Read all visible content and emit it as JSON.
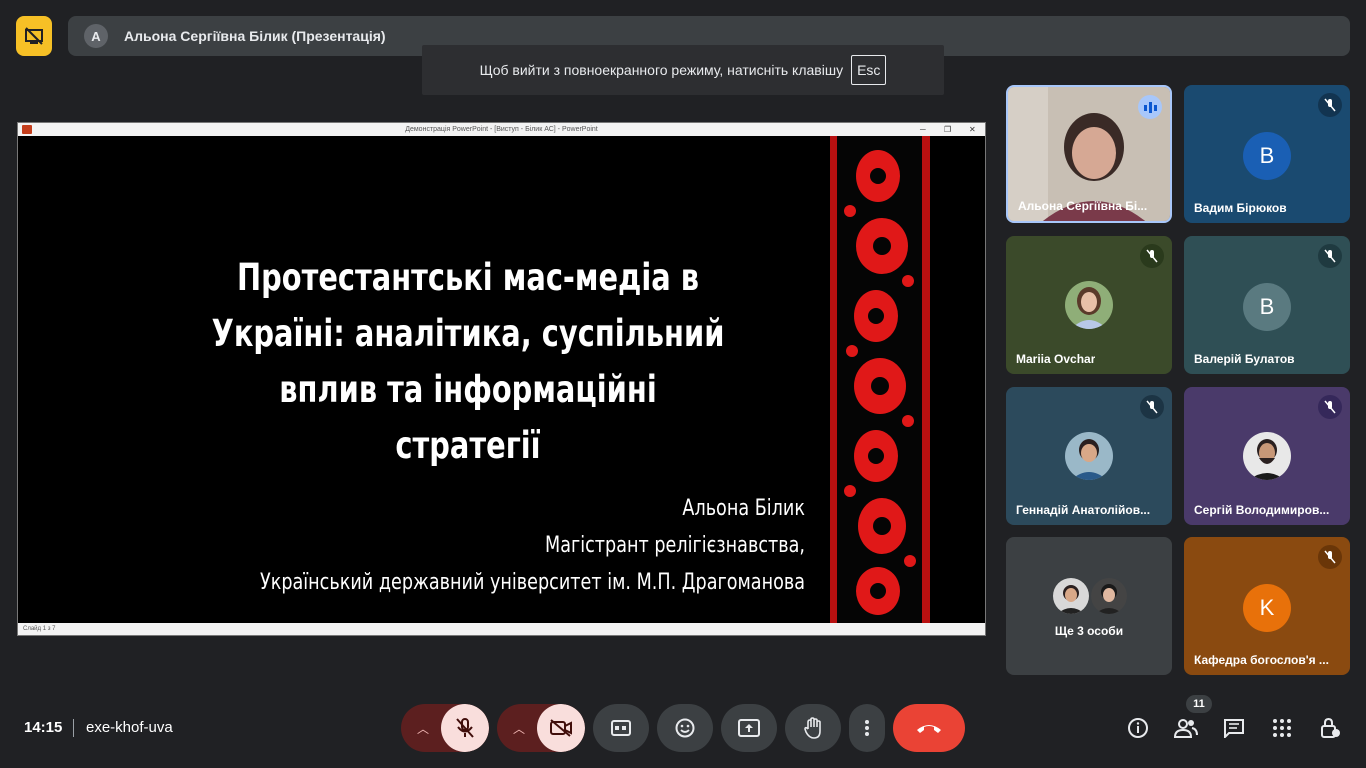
{
  "header": {
    "presenter_initial": "A",
    "presenter_title": "Альона Сергіївна Білик (Презентація)"
  },
  "toast": {
    "message": "Щоб вийти з повноекранного режиму, натисніть клавішу",
    "key": "Esc"
  },
  "presentation": {
    "window_title": "Демонстрація PowerPoint - [Виступ - Білик АС] - PowerPoint",
    "status": "Слайд 1 з 7",
    "title_lines": [
      "Протестантські мас-медіа в",
      "Україні: аналітика, суспільний",
      "вплив та інформаційні стратегії"
    ],
    "author_lines": [
      "Альона Білик",
      "Магістрант релігієзнавства,",
      "Український державний університет ім. М.П. Драгоманова"
    ]
  },
  "participants": [
    {
      "name": "Альона Сергіївна Бі...",
      "type": "photo",
      "speaking": true
    },
    {
      "name": "Вадим Бірюков",
      "initial": "B",
      "muted": true,
      "bg": "#1a4a70",
      "avatar_color": "#1a5fb4"
    },
    {
      "name": "Mariia Ovchar",
      "type": "photo",
      "muted": true,
      "bg": "#3b4a2a"
    },
    {
      "name": "Валерій Булатов",
      "initial": "B",
      "muted": true,
      "bg": "#2f4f55",
      "avatar_color": "#5a7a80"
    },
    {
      "name": "Геннадій Анатолійов...",
      "type": "photo",
      "muted": true,
      "bg": "#2c4a5c"
    },
    {
      "name": "Сергій Володимиров...",
      "type": "photo",
      "muted": true,
      "bg": "#4a3a6a"
    },
    {
      "name": "Ще 3 особи",
      "type": "group"
    },
    {
      "name": "Кафедра богослов'я ...",
      "initial": "K",
      "muted": true,
      "bg": "#8a4a10",
      "avatar_color": "#e8710a"
    }
  ],
  "footer": {
    "time": "14:15",
    "meeting_code": "exe-khof-uva",
    "people_count": "11"
  },
  "colors": {
    "accent_yellow": "#f6c026",
    "danger_red": "#ea4335",
    "surface": "#3c4043",
    "background": "#202124"
  }
}
